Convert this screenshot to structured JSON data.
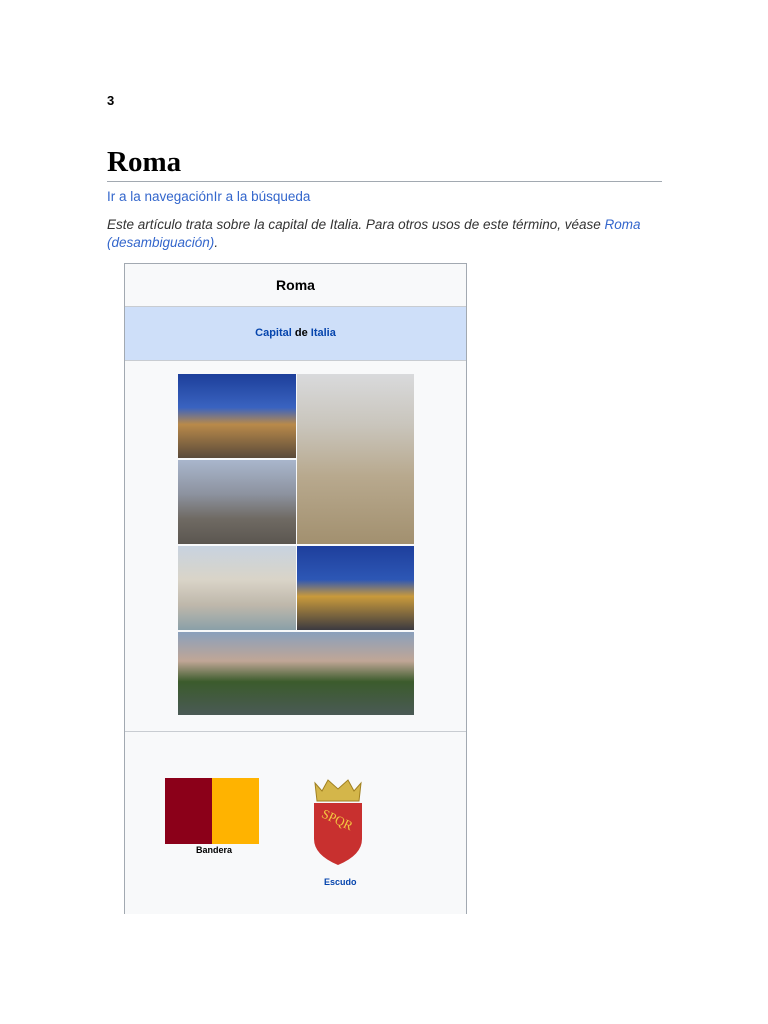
{
  "page_number": "3",
  "title": "Roma",
  "nav_links": "Ir a la navegaciónIr a la búsqueda",
  "hatnote": {
    "text": "Este artículo trata sobre la capital de Italia. Para otros usos de este término, véase ",
    "link": "Roma (desambiguación)",
    "end": "."
  },
  "infobox": {
    "title": "Roma",
    "subtitle": {
      "capital": "Capital",
      "de": " de ",
      "italia": "Italia"
    },
    "flag": {
      "caption": "Bandera",
      "colors": [
        "#8b0019",
        "#ffb300"
      ]
    },
    "coat_of_arms": {
      "caption": "Escudo",
      "motto": "SPQR"
    },
    "link_color": "#0645ad"
  }
}
